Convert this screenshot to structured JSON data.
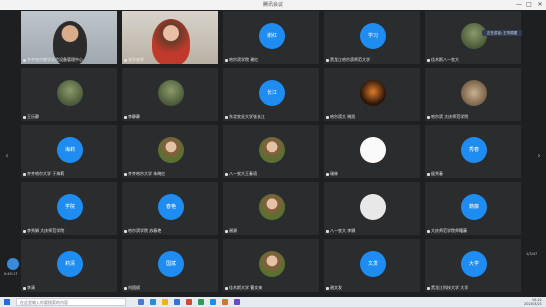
{
  "window": {
    "title": "腾讯会议",
    "minimize": "—",
    "maximize": "□",
    "close": "✕"
  },
  "nav": {
    "prev": "‹",
    "next": "›"
  },
  "overlay": {
    "speaker_tag": "正在讲话: 王毕振图"
  },
  "side": {
    "left_button_label": "0:45:17",
    "right_label": "1/3/47"
  },
  "tiles": [
    {
      "name": "齐齐哈尔教学实验设备管理中心",
      "avatar": "video",
      "text": ""
    },
    {
      "name": "张华老师",
      "avatar": "video",
      "text": ""
    },
    {
      "name": "哈尔滨学院 谢红",
      "avatar": "text",
      "text": "谢红"
    },
    {
      "name": "黑龙江哈尔滨师范大学",
      "avatar": "text",
      "text": "学习"
    },
    {
      "name": "佳木斯八一农大",
      "avatar": "photo",
      "text": ""
    },
    {
      "name": "王乐静",
      "avatar": "photo",
      "text": ""
    },
    {
      "name": "李静静",
      "avatar": "photo",
      "text": ""
    },
    {
      "name": "东北农业大学张长江",
      "avatar": "text",
      "text": "长江"
    },
    {
      "name": "哈尔滨大 晓凯",
      "avatar": "dark",
      "text": ""
    },
    {
      "name": "哈尔滨 大庆师范学院",
      "avatar": "stone",
      "text": ""
    },
    {
      "name": "齐齐哈尔大学 于海莉",
      "avatar": "text",
      "text": "海莉"
    },
    {
      "name": "齐齐哈尔大学 朱晓红",
      "avatar": "portrait",
      "text": ""
    },
    {
      "name": "八一农大王春语",
      "avatar": "portrait",
      "text": ""
    },
    {
      "name": "瑞林",
      "avatar": "plain",
      "text": ""
    },
    {
      "name": "侯秀春",
      "avatar": "text",
      "text": "秀春"
    },
    {
      "name": "李秀娟 大庆师范学院",
      "avatar": "text",
      "text": "学院"
    },
    {
      "name": "哈尔滨学院 苏春艳",
      "avatar": "text",
      "text": "春艳"
    },
    {
      "name": "谢源",
      "avatar": "portrait",
      "text": ""
    },
    {
      "name": "八一农大 李娜",
      "avatar": "light",
      "text": ""
    },
    {
      "name": "大庆师范学院师籍藤",
      "avatar": "text",
      "text": "籍藤"
    },
    {
      "name": "李清",
      "avatar": "text",
      "text": "莉清"
    },
    {
      "name": "刘国斌",
      "avatar": "text",
      "text": "国斌"
    },
    {
      "name": "佳木斯大学 曹文来",
      "avatar": "portrait",
      "text": ""
    },
    {
      "name": "谢文发",
      "avatar": "text",
      "text": "文发"
    },
    {
      "name": "黑龙江科技大学 大学",
      "avatar": "text",
      "text": "大学"
    }
  ],
  "taskbar": {
    "search_placeholder": "在这里输入你要搜索的内容",
    "time": "10:21",
    "date": "2020/3/21"
  }
}
